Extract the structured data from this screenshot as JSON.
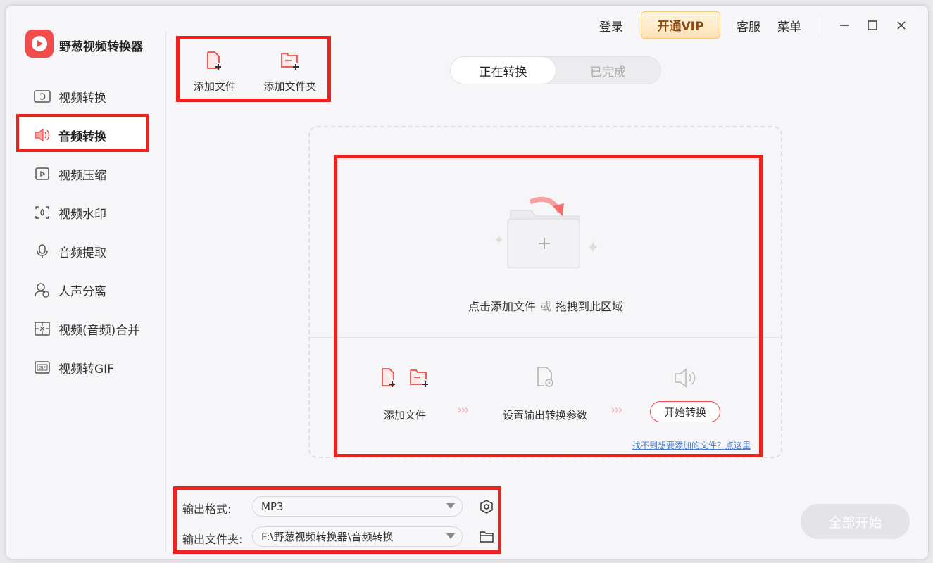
{
  "app": {
    "name": "野葱视频转换器"
  },
  "sidebar": {
    "items": [
      {
        "label": "视频转换",
        "icon": "video-convert-icon"
      },
      {
        "label": "音频转换",
        "icon": "audio-convert-icon",
        "active": true
      },
      {
        "label": "视频压缩",
        "icon": "video-compress-icon"
      },
      {
        "label": "视频水印",
        "icon": "video-watermark-icon"
      },
      {
        "label": "音频提取",
        "icon": "audio-extract-icon"
      },
      {
        "label": "人声分离",
        "icon": "vocal-separate-icon"
      },
      {
        "label": "视频(音频)合并",
        "icon": "merge-icon"
      },
      {
        "label": "视频转GIF",
        "icon": "gif-icon"
      }
    ]
  },
  "topbar": {
    "login": "登录",
    "vip": "开通VIP",
    "support": "客服",
    "menu": "菜单"
  },
  "toolbar": {
    "add_file": "添加文件",
    "add_folder": "添加文件夹"
  },
  "tabs": [
    {
      "label": "正在转换",
      "active": true
    },
    {
      "label": "已完成",
      "active": false
    }
  ],
  "dropzone": {
    "hint_main": "点击添加文件",
    "hint_or": "或",
    "hint_drag": "拖拽到此区域",
    "step1": "添加文件",
    "step2": "设置输出转换参数",
    "step3": "开始转换",
    "help_link": "找不到想要添加的文件？点这里"
  },
  "settings": {
    "format_label": "输出格式:",
    "format_value": "MP3",
    "folder_label": "输出文件夹:",
    "folder_value": "F:\\野葱视频转换器\\音频转换"
  },
  "start_all": "全部开始",
  "colors": {
    "accent": "#f24c4c",
    "annotation": "#f0201d",
    "vip_text": "#8a4a12"
  }
}
